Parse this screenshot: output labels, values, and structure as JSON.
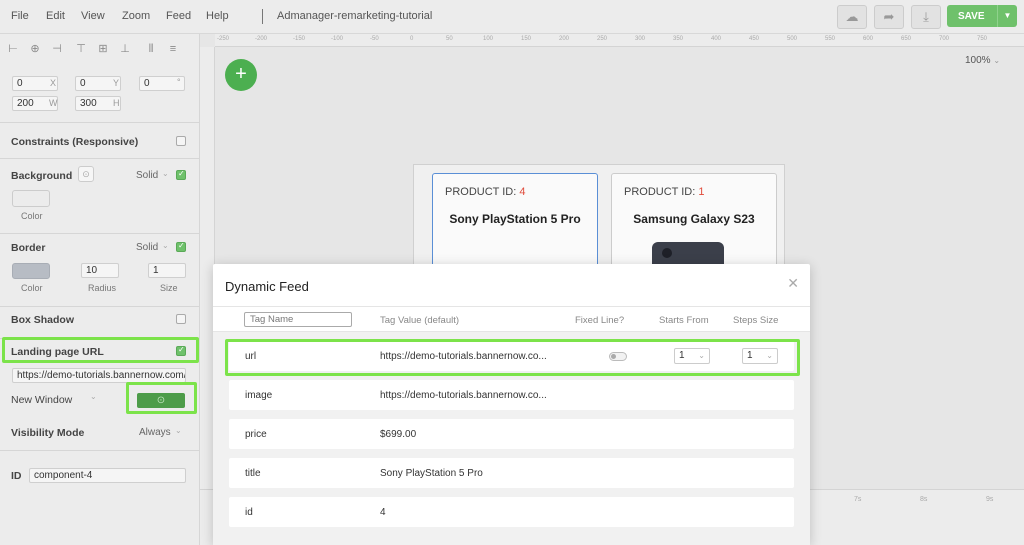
{
  "menu": {
    "items": [
      "File",
      "Edit",
      "View",
      "Zoom",
      "Feed",
      "Help"
    ],
    "title": "Admanager-remarketing-tutorial",
    "save_label": "SAVE"
  },
  "props": {
    "x": "0",
    "y": "0",
    "rotation": "0",
    "w": "200",
    "h": "300",
    "x_label": "X",
    "y_label": "Y",
    "r_label": "°",
    "w_label": "W",
    "h_label": "H",
    "constraints": "Constraints (Responsive)",
    "background": {
      "title": "Background",
      "mode": "Solid",
      "color_label": "Color",
      "swatch": "#ffffff"
    },
    "border": {
      "title": "Border",
      "mode": "Solid",
      "color_label": "Color",
      "radius": "10",
      "radius_label": "Radius",
      "size": "1",
      "size_label": "Size",
      "swatch": "#b7bcc4"
    },
    "box_shadow": "Box Shadow",
    "landing": {
      "title": "Landing page URL",
      "url": "https://demo-tutorials.bannernow.com/a"
    },
    "new_window": "New Window",
    "visibility": {
      "label": "Visibility Mode",
      "value": "Always"
    },
    "id": {
      "label": "ID",
      "value": "component-4"
    }
  },
  "canvas": {
    "zoom": "100%",
    "ruler_ticks": [
      "-250",
      "-200",
      "-150",
      "-100",
      "-50",
      "0",
      "50",
      "100",
      "150",
      "200",
      "250",
      "300",
      "350",
      "400",
      "450",
      "500",
      "550",
      "600",
      "650",
      "700",
      "750"
    ],
    "cards": [
      {
        "pid_label": "PRODUCT ID:",
        "pid": "4",
        "name": "Sony PlayStation 5 Pro"
      },
      {
        "pid_label": "PRODUCT ID:",
        "pid": "1",
        "name": "Samsung Galaxy S23"
      }
    ],
    "timeline_ticks": [
      "7s",
      "8s",
      "9s"
    ]
  },
  "dialog": {
    "title": "Dynamic Feed",
    "headers": {
      "tag_name": "Tag Name",
      "tag_value": "Tag Value (default)",
      "fixed_line": "Fixed Line?",
      "starts_from": "Starts From",
      "steps_size": "Steps Size"
    },
    "rows": [
      {
        "name": "url",
        "value": "https://demo-tutorials.bannernow.co...",
        "starts": "1",
        "steps": "1"
      },
      {
        "name": "image",
        "value": "https://demo-tutorials.bannernow.co..."
      },
      {
        "name": "price",
        "value": "$699.00"
      },
      {
        "name": "title",
        "value": "Sony PlayStation 5 Pro"
      },
      {
        "name": "id",
        "value": "4"
      }
    ]
  },
  "colors": {
    "accent": "#6fc16b",
    "highlight": "#7ce34a",
    "red": "#e04a3a"
  }
}
